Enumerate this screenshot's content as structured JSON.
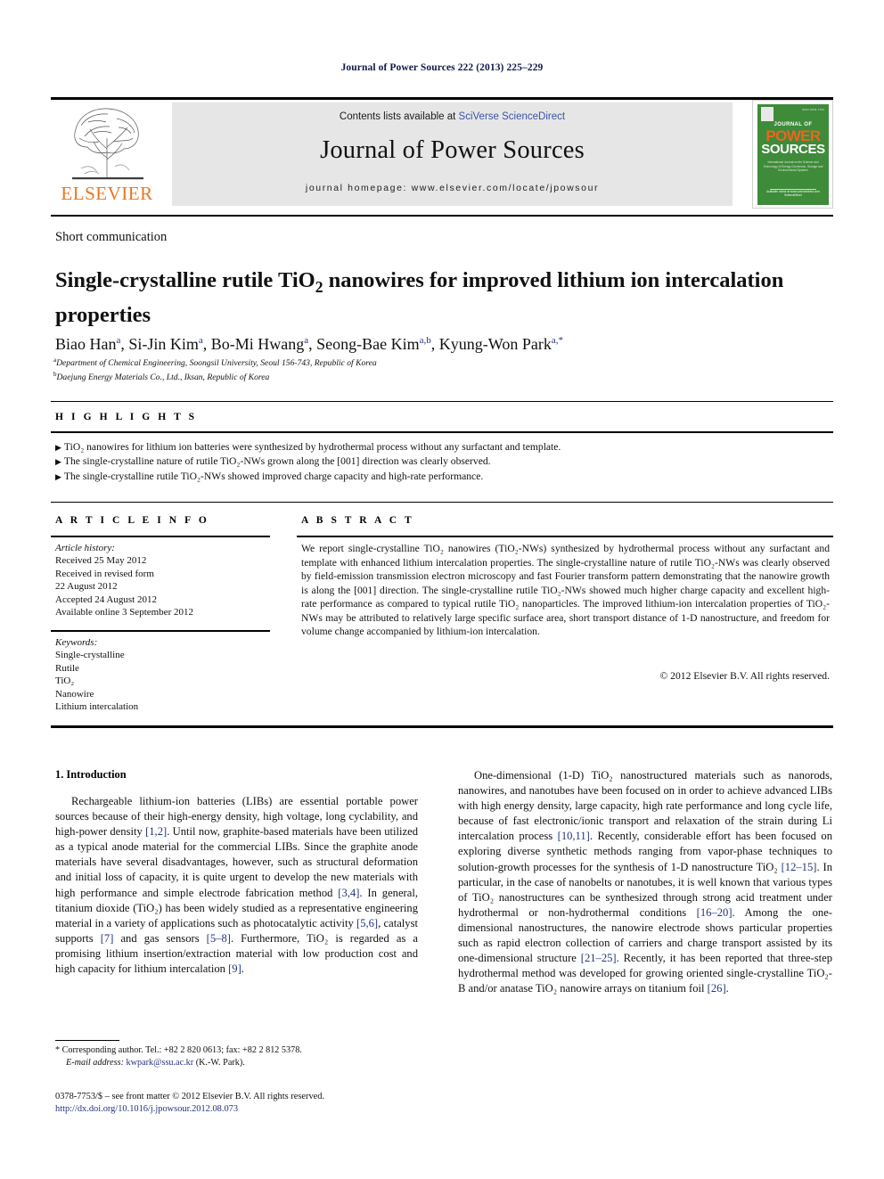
{
  "running_head": "Journal of Power Sources 222 (2013) 225–229",
  "masthead": {
    "publisher_name": "ELSEVIER",
    "contents_prefix": "Contents lists available at ",
    "contents_link": "SciVerse ScienceDirect",
    "journal_name": "Journal of Power Sources",
    "homepage": "journal homepage: www.elsevier.com/locate/jpowsour",
    "cover": {
      "issn_top": "ISSN 0378-7753",
      "line1": "JOURNAL OF",
      "line2": "POWER",
      "line3": "SOURCES",
      "subtitle": "International Journal on the Science and Technology of Energy Conversion, Storage and Environmental Systems",
      "footer": "Available online at www.sciencedirect.com ScienceDirect"
    }
  },
  "article": {
    "section_label": "Short communication",
    "title_part1": "Single-crystalline rutile TiO",
    "title_sub": "2",
    "title_part2": " nanowires for improved lithium ion intercalation properties",
    "authors": [
      {
        "name": "Biao Han",
        "sup": "a",
        "sep": ", "
      },
      {
        "name": "Si-Jin Kim",
        "sup": "a",
        "sep": ", "
      },
      {
        "name": "Bo-Mi Hwang",
        "sup": "a",
        "sep": ", "
      },
      {
        "name": "Seong-Bae Kim",
        "sup": "a,b",
        "sep": ", "
      },
      {
        "name": "Kyung-Won Park",
        "sup": "a,*",
        "sep": ""
      }
    ],
    "affiliations": [
      {
        "sup": "a",
        "text": "Department of Chemical Engineering, Soongsil University, Seoul 156-743, Republic of Korea"
      },
      {
        "sup": "b",
        "text": "Daejung Energy Materials Co., Ltd., Iksan, Republic of Korea"
      }
    ]
  },
  "highlights": {
    "heading": "H I G H L I G H T S",
    "bullet_glyph": "▶",
    "items": [
      "TiO₂ nanowires for lithium ion batteries were synthesized by hydrothermal process without any surfactant and template.",
      "The single-crystalline nature of rutile TiO₂-NWs grown along the [001] direction was clearly observed.",
      "The single-crystalline rutile TiO₂-NWs showed improved charge capacity and high-rate performance."
    ]
  },
  "article_info": {
    "heading": "A R T I C L E   I N F O",
    "history_label": "Article history:",
    "history_lines": [
      "Received 25 May 2012",
      "Received in revised form",
      "22 August 2012",
      "Accepted 24 August 2012",
      "Available online 3 September 2012"
    ],
    "keywords_label": "Keywords:",
    "keywords": [
      "Single-crystalline",
      "Rutile",
      "TiO₂",
      "Nanowire",
      "Lithium intercalation"
    ]
  },
  "abstract": {
    "heading": "A B S T R A C T",
    "text": "We report single-crystalline TiO₂ nanowires (TiO₂-NWs) synthesized by hydrothermal process without any surfactant and template with enhanced lithium intercalation properties. The single-crystalline nature of rutile TiO₂-NWs was clearly observed by field-emission transmission electron microscopy and fast Fourier transform pattern demonstrating that the nanowire growth is along the [001] direction. The single-crystalline rutile TiO₂-NWs showed much higher charge capacity and excellent high-rate performance as compared to typical rutile TiO₂ nanoparticles. The improved lithium-ion intercalation properties of TiO₂-NWs may be attributed to relatively large specific surface area, short transport distance of 1-D nanostructure, and freedom for volume change accompanied by lithium-ion intercalation.",
    "copyright": "© 2012 Elsevier B.V. All rights reserved."
  },
  "body": {
    "intro_heading": "1.  Introduction",
    "left_paragraph": "Rechargeable lithium-ion batteries (LIBs) are essential portable power sources because of their high-energy density, high voltage, long cyclability, and high-power density [1,2]. Until now, graphite-based materials have been utilized as a typical anode material for the commercial LIBs. Since the graphite anode materials have several disadvantages, however, such as structural deformation and initial loss of capacity, it is quite urgent to develop the new materials with high performance and simple electrode fabrication method [3,4]. In general, titanium dioxide (TiO₂) has been widely studied as a representative engineering material in a variety of applications such as photocatalytic activity [5,6], catalyst supports [7] and gas sensors [5–8]. Furthermore, TiO₂ is regarded as a promising lithium insertion/extraction material with low production cost and high capacity for lithium intercalation [9].",
    "right_paragraph": "One-dimensional (1-D) TiO₂ nanostructured materials such as nanorods, nanowires, and nanotubes have been focused on in order to achieve advanced LIBs with high energy density, large capacity, high rate performance and long cycle life, because of fast electronic/ionic transport and relaxation of the strain during Li intercalation process [10,11]. Recently, considerable effort has been focused on exploring diverse synthetic methods ranging from vapor-phase techniques to solution-growth processes for the synthesis of 1-D nanostructure TiO₂ [12–15]. In particular, in the case of nanobelts or nanotubes, it is well known that various types of TiO₂ nanostructures can be synthesized through strong acid treatment under hydrothermal or non-hydrothermal conditions [16–20]. Among the one-dimensional nanostructures, the nanowire electrode shows particular properties such as rapid electron collection of carriers and charge transport assisted by its one-dimensional structure [21–25]. Recently, it has been reported that three-step hydrothermal method was developed for growing oriented single-crystalline TiO₂-B and/or anatase TiO₂ nanowire arrays on titanium foil [26]."
  },
  "footer": {
    "corresponding_marker": "*",
    "corresponding": "Corresponding author. Tel.: +82 2 820 0613; fax: +82 2 812 5378.",
    "email_label": "E-mail address:",
    "email": "kwpark@ssu.ac.kr",
    "email_suffix": " (K.-W. Park).",
    "imprint": "0378-7753/$ – see front matter © 2012 Elsevier B.V. All rights reserved.",
    "doi": "http://dx.doi.org/10.1016/j.jpowsour.2012.08.073"
  },
  "colors": {
    "link": "#3a53a4",
    "cite": "#24347e",
    "elsevier_orange": "#e87722",
    "cover_green": "#3e8b3a",
    "band_gray": "#e6e6e6"
  }
}
